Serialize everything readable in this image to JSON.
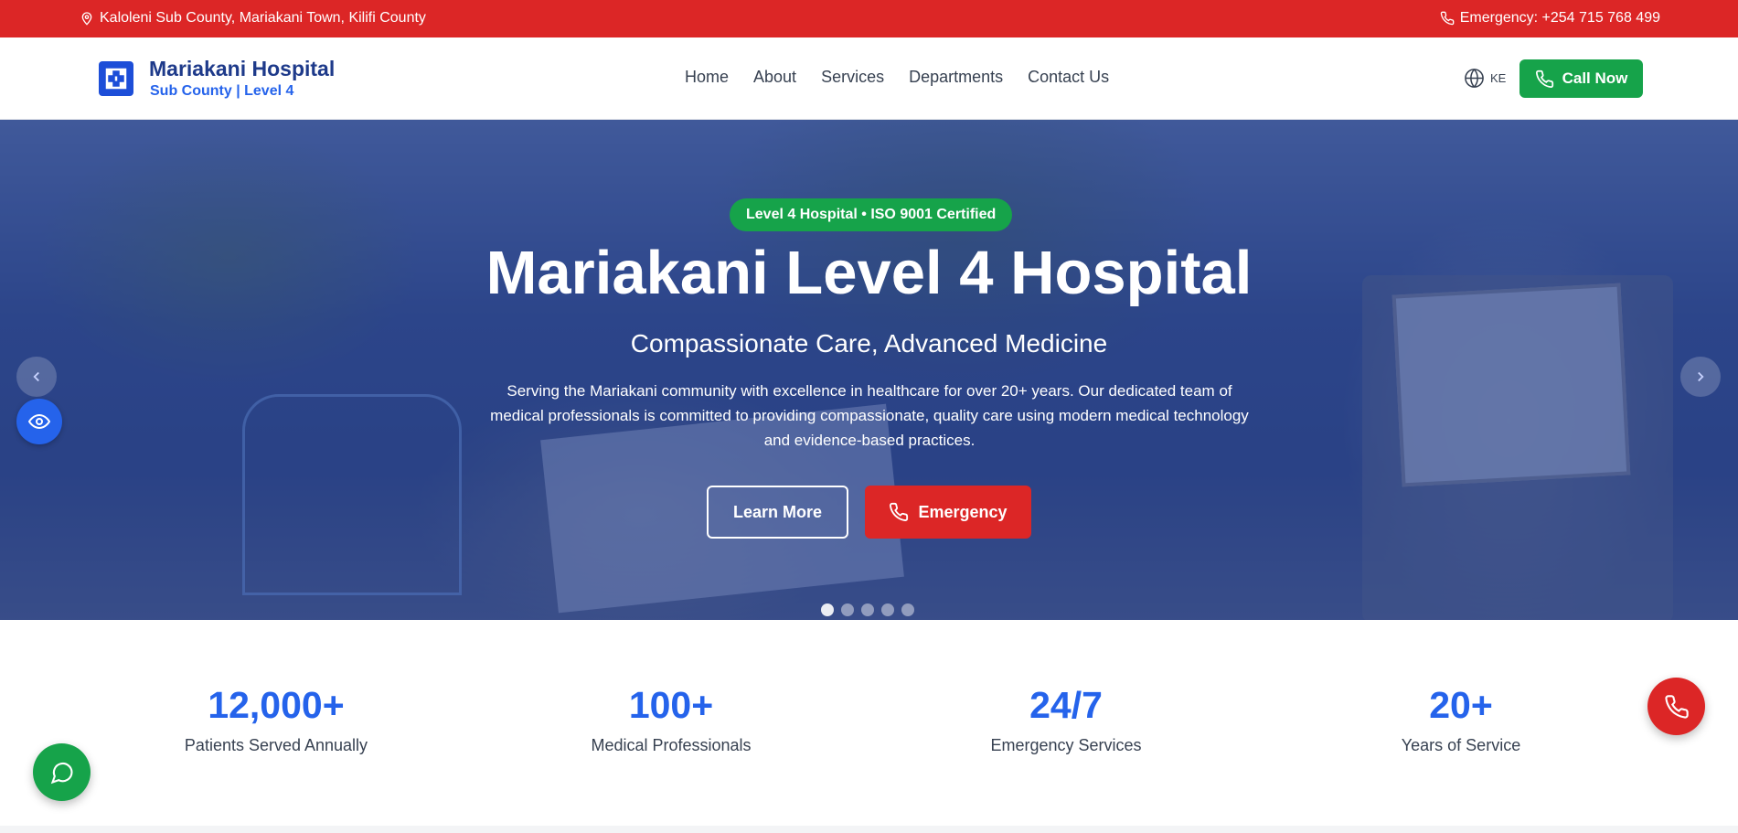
{
  "topbar": {
    "location": "Kaloleni Sub County, Mariakani Town, Kilifi County",
    "emergency": "Emergency: +254 715 768 499",
    "location_icon": "map-pin-icon",
    "phone_icon": "phone-icon"
  },
  "header": {
    "brand_title": "Mariakani Hospital",
    "brand_subtitle": "Sub County | Level 4",
    "nav": [
      "Home",
      "About",
      "Services",
      "Departments",
      "Contact Us"
    ],
    "lang_code": "KE",
    "call_label": "Call Now"
  },
  "hero": {
    "badge": "Level 4 Hospital • ISO 9001 Certified",
    "title": "Mariakani Level 4 Hospital",
    "tagline": "Compassionate Care, Advanced Medicine",
    "description": "Serving the Mariakani community with excellence in healthcare for over 20+ years. Our dedicated team of medical professionals is committed to providing compassionate, quality care using modern medical technology and evidence-based practices.",
    "learn_more": "Learn More",
    "emergency": "Emergency",
    "slide_count": 5,
    "active_slide": 1
  },
  "stats": [
    {
      "value": "12,000+",
      "label": "Patients Served Annually"
    },
    {
      "value": "100+",
      "label": "Medical Professionals"
    },
    {
      "value": "24/7",
      "label": "Emergency Services"
    },
    {
      "value": "20+",
      "label": "Years of Service"
    }
  ],
  "colors": {
    "topbar": "#dc2626",
    "brand": "#1e3a8a",
    "accent": "#2563eb",
    "success": "#16a34a",
    "danger": "#dc2626"
  }
}
